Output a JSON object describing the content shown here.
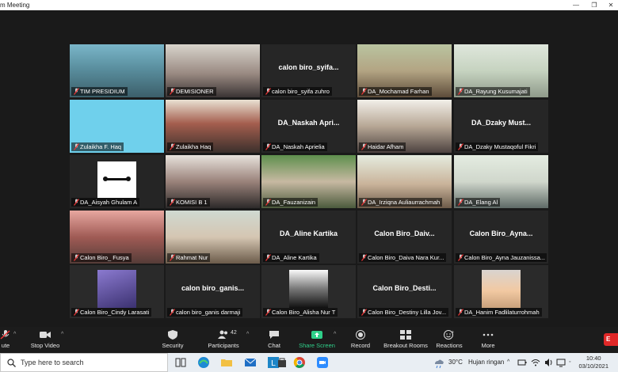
{
  "window": {
    "title": "m Meeting"
  },
  "tiles": [
    {
      "name": "TIM PRESIDIUM",
      "active": true,
      "video": true
    },
    {
      "name": "DEMISIONER",
      "video": true
    },
    {
      "name": "calon biro_syifa zuhro",
      "center": "calon biro_syifa...",
      "video": false
    },
    {
      "name": "DA_Mochamad Farhan",
      "video": true
    },
    {
      "name": "DA_Rayung Kusumajati",
      "video": true
    },
    {
      "name": "Zulaikha F. Haq",
      "video": true
    },
    {
      "name": "Zulaikha Haq",
      "video": true
    },
    {
      "name": "DA_Naskah Aprielia",
      "center": "DA_Naskah Apri...",
      "video": false
    },
    {
      "name": "Haidar Afham",
      "video": true
    },
    {
      "name": "DA_Dzaky Mustaqoful Fikri",
      "center": "DA_Dzaky Must...",
      "video": false
    },
    {
      "name": "DA_Aisyah Ghulam A",
      "video": true
    },
    {
      "name": "KOMISI B 1",
      "video": true
    },
    {
      "name": "DA_Fauzanizain",
      "video": true
    },
    {
      "name": "DA_Irziqna Auliaurrachmah",
      "video": true
    },
    {
      "name": "DA_Elang Al",
      "video": true
    },
    {
      "name": "Calon Biro_ Fusya",
      "video": true
    },
    {
      "name": "Rahmat Nur",
      "video": true
    },
    {
      "name": "DA_Aline Kartika",
      "center": "DA_Aline Kartika",
      "video": false
    },
    {
      "name": "Calon Biro_Daiva Nara Kur...",
      "center": "Calon Biro_Daiv...",
      "video": false
    },
    {
      "name": "Calon Biro_Ayna Jauzanissa...",
      "center": "Calon Biro_Ayna...",
      "video": false
    },
    {
      "name": "Calon Biro_Cindy Larasati",
      "video": true
    },
    {
      "name": "calon biro_ganis darmaji",
      "center": "calon biro_ganis...",
      "video": false
    },
    {
      "name": "Calon Biro_Alisha Nur T",
      "video": true
    },
    {
      "name": "Calon Biro_Destiny Lilla Jov...",
      "center": "Calon Biro_Desti...",
      "video": false
    },
    {
      "name": "DA_Hanim Fadlilaturrohmah",
      "video": true
    }
  ],
  "toolbar": {
    "mute": "ute",
    "stop_video": "Stop Video",
    "security": "Security",
    "participants": "Participants",
    "participants_count": "42",
    "chat": "Chat",
    "share_screen": "Share Screen",
    "record": "Record",
    "breakout": "Breakout Rooms",
    "reactions": "Reactions",
    "more": "More",
    "end": "E"
  },
  "taskbar": {
    "search_placeholder": "Type here to search",
    "weather_temp": "30°C",
    "weather_desc": "Hujan ringan",
    "time": "10:40",
    "date": "03/10/2021"
  },
  "colors": {
    "accent_green": "#2fd08a",
    "active_border": "#c8d86a",
    "end_red": "#e02828"
  }
}
